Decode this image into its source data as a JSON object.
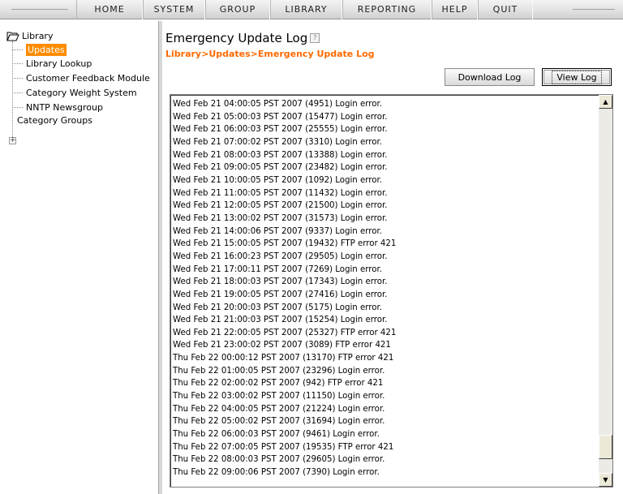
{
  "nav": {
    "items": [
      "HOME",
      "SYSTEM",
      "GROUP",
      "LIBRARY",
      "REPORTING",
      "HELP",
      "QUIT"
    ]
  },
  "sidebar": {
    "root_label": "Library",
    "items": [
      "Updates",
      "Library Lookup",
      "Customer Feedback Module",
      "Category Weight System",
      "NNTP Newsgroup"
    ],
    "group_label": "Category Groups",
    "expander": "+"
  },
  "main": {
    "title": "Emergency Update Log",
    "help_icon": "?",
    "breadcrumb": "Library>Updates>Emergency Update Log",
    "download_button": "Download Log",
    "view_button": "View Log"
  },
  "log": {
    "lines": [
      "Wed Feb 21 04:00:05 PST 2007 (4951) Login error.",
      "Wed Feb 21 05:00:03 PST 2007 (15477) Login error.",
      "Wed Feb 21 06:00:03 PST 2007 (25555) Login error.",
      "Wed Feb 21 07:00:02 PST 2007 (3310) Login error.",
      "Wed Feb 21 08:00:03 PST 2007 (13388) Login error.",
      "Wed Feb 21 09:00:05 PST 2007 (23482) Login error.",
      "Wed Feb 21 10:00:05 PST 2007 (1092) Login error.",
      "Wed Feb 21 11:00:05 PST 2007 (11432) Login error.",
      "Wed Feb 21 12:00:05 PST 2007 (21500) Login error.",
      "Wed Feb 21 13:00:02 PST 2007 (31573) Login error.",
      "Wed Feb 21 14:00:06 PST 2007 (9337) Login error.",
      "Wed Feb 21 15:00:05 PST 2007 (19432) FTP error 421",
      "Wed Feb 21 16:00:23 PST 2007 (29505) Login error.",
      "Wed Feb 21 17:00:11 PST 2007 (7269) Login error.",
      "Wed Feb 21 18:00:03 PST 2007 (17343) Login error.",
      "Wed Feb 21 19:00:05 PST 2007 (27416) Login error.",
      "Wed Feb 21 20:00:03 PST 2007 (5175) Login error.",
      "Wed Feb 21 21:00:03 PST 2007 (15254) Login error.",
      "Wed Feb 21 22:00:05 PST 2007 (25327) FTP error 421",
      "Wed Feb 21 23:00:02 PST 2007 (3089) FTP error 421",
      "Thu Feb 22 00:00:12 PST 2007 (13170) FTP error 421",
      "Thu Feb 22 01:00:05 PST 2007 (23296) Login error.",
      "Thu Feb 22 02:00:02 PST 2007 (942) FTP error 421",
      "Thu Feb 22 03:00:02 PST 2007 (11150) Login error.",
      "Thu Feb 22 04:00:05 PST 2007 (21224) Login error.",
      "Thu Feb 22 05:00:02 PST 2007 (31694) Login error.",
      "Thu Feb 22 06:00:03 PST 2007 (9461) Login error.",
      "Thu Feb 22 07:00:05 PST 2007 (19535) FTP error 421",
      "Thu Feb 22 08:00:03 PST 2007 (29605) Login error.",
      "Thu Feb 22 09:00:06 PST 2007 (7390) Login error."
    ]
  },
  "scrollbar": {
    "up_icon": "▲",
    "down_icon": "▼",
    "position_fraction": 0.96
  },
  "colors": {
    "accent": "#ff6a00",
    "selected_bg": "#ff8c00"
  }
}
